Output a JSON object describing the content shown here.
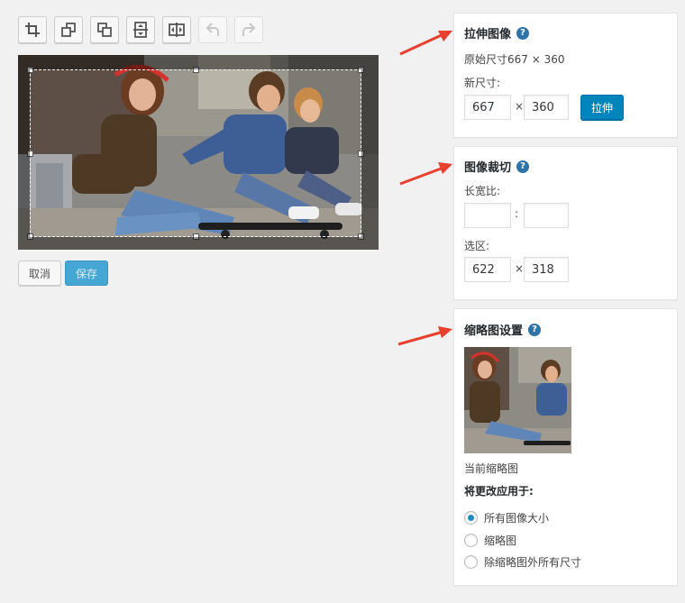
{
  "toolbar": {
    "buttons": [
      {
        "name": "crop-icon",
        "enabled": true
      },
      {
        "name": "rotate-left-icon",
        "enabled": true
      },
      {
        "name": "rotate-right-icon",
        "enabled": true
      },
      {
        "name": "flip-vertical-icon",
        "enabled": true
      },
      {
        "name": "flip-horizontal-icon",
        "enabled": true
      },
      {
        "name": "undo-icon",
        "enabled": false
      },
      {
        "name": "redo-icon",
        "enabled": false
      }
    ]
  },
  "actions": {
    "cancel_label": "取消",
    "save_label": "保存"
  },
  "scale": {
    "title": "拉伸图像",
    "original_size": "原始尺寸667 × 360",
    "new_size_label": "新尺寸:",
    "width": "667",
    "height": "360",
    "times": "×",
    "button_label": "拉伸"
  },
  "crop": {
    "title": "图像裁切",
    "aspect_label": "长宽比:",
    "aspect_w": "",
    "aspect_h": "",
    "colon": ":",
    "selection_label": "选区:",
    "sel_w": "622",
    "sel_h": "318",
    "times": "×"
  },
  "thumbnail": {
    "title": "缩略图设置",
    "current_label": "当前缩略图",
    "apply_label": "将更改应用于:",
    "options": [
      {
        "label": "所有图像大小",
        "checked": true
      },
      {
        "label": "缩略图",
        "checked": false
      },
      {
        "label": "除缩略图外所有尺寸",
        "checked": false
      }
    ]
  },
  "colors": {
    "primary": "#0085ba",
    "help": "#2e74a8",
    "arrow": "#e8402f"
  }
}
